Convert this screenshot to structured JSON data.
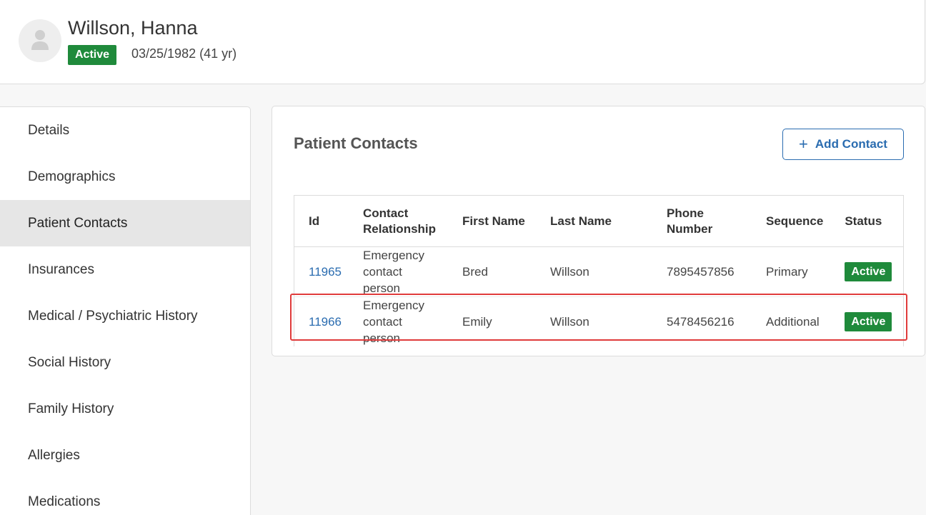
{
  "patient": {
    "name": "Willson, Hanna",
    "status": "Active",
    "dob": "03/25/1982 (41 yr)"
  },
  "sidebar": {
    "items": [
      {
        "label": "Details"
      },
      {
        "label": "Demographics"
      },
      {
        "label": "Patient Contacts"
      },
      {
        "label": "Insurances"
      },
      {
        "label": "Medical / Psychiatric History"
      },
      {
        "label": "Social History"
      },
      {
        "label": "Family History"
      },
      {
        "label": "Allergies"
      },
      {
        "label": "Medications"
      }
    ],
    "active": "Patient Contacts"
  },
  "main": {
    "title": "Patient Contacts",
    "add_button_label": "Add Contact",
    "add_button_icon": "plus-icon",
    "table": {
      "headers": [
        "Id",
        "Contact Relationship",
        "First Name",
        "Last Name",
        "Phone Number",
        "Sequence",
        "Status"
      ],
      "rows": [
        {
          "id": "11965",
          "relationship": "Emergency contact person",
          "first_name": "Bred",
          "last_name": "Willson",
          "phone": "7895457856",
          "sequence": "Primary",
          "status": "Active"
        },
        {
          "id": "11966",
          "relationship": "Emergency contact person",
          "first_name": "Emily",
          "last_name": "Willson",
          "phone": "5478456216",
          "sequence": "Additional",
          "status": "Active"
        }
      ]
    }
  },
  "colors": {
    "status_green": "#1f8a3b",
    "link_blue": "#2a6cb0",
    "highlight_red": "#e03b3b"
  }
}
